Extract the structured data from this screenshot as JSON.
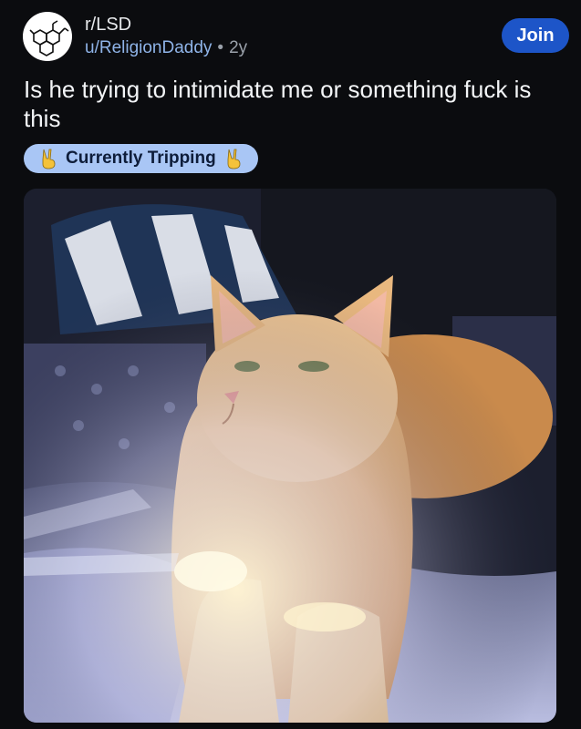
{
  "post": {
    "subreddit": "r/LSD",
    "author": "u/ReligionDaddy",
    "separator": "•",
    "age": "2y",
    "join_label": "Join",
    "title": "Is he trying to intimidate me or something fuck is this",
    "flair": {
      "text": "Currently Tripping",
      "emoji": "victory-hand"
    },
    "image": {
      "subject": "orange-cat"
    }
  },
  "colors": {
    "background": "#0b0c0f",
    "join_button": "#1d55c8",
    "flair_bg": "#a9c6f5",
    "author_link": "#8fb4e8"
  }
}
